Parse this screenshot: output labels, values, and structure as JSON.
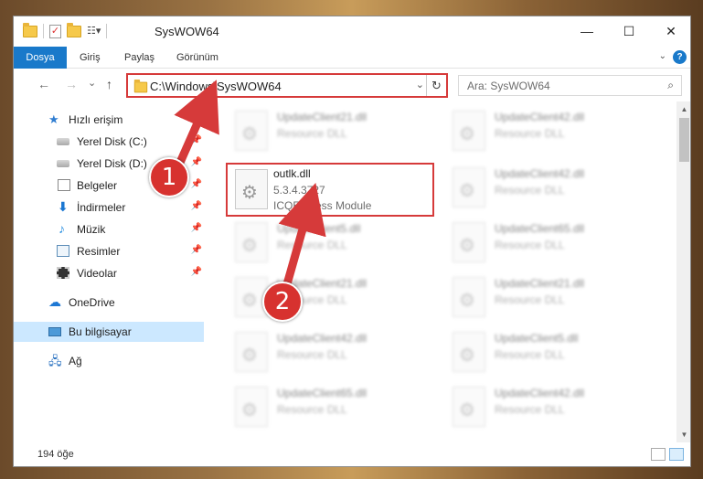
{
  "window": {
    "title": "SysWOW64",
    "controls": {
      "minimize": "—",
      "maximize": "☐",
      "close": "✕"
    }
  },
  "ribbon": {
    "tabs": [
      "Dosya",
      "Giriş",
      "Paylaş",
      "Görünüm"
    ],
    "help": "?"
  },
  "nav": {
    "back": "←",
    "forward": "→",
    "recent": "⌄",
    "up": "↑",
    "address": "C:\\Windows\\SysWOW64",
    "search_placeholder": "Ara: SysWOW64",
    "refresh": "↻",
    "search_icon": "⌕"
  },
  "sidebar": {
    "items": [
      {
        "label": "Hızlı erişim",
        "icon": "star-icon",
        "pinned": false
      },
      {
        "label": "Yerel Disk (C:)",
        "icon": "disk-icon",
        "pinned": true
      },
      {
        "label": "Yerel Disk (D:)",
        "icon": "disk-icon",
        "pinned": true
      },
      {
        "label": "Belgeler",
        "icon": "documents-icon",
        "pinned": true
      },
      {
        "label": "İndirmeler",
        "icon": "download-icon",
        "pinned": true
      },
      {
        "label": "Müzik",
        "icon": "music-icon",
        "pinned": true
      },
      {
        "label": "Resimler",
        "icon": "pictures-icon",
        "pinned": true
      },
      {
        "label": "Videolar",
        "icon": "videos-icon",
        "pinned": true
      },
      {
        "label": "OneDrive",
        "icon": "cloud-icon",
        "pinned": false
      },
      {
        "label": "Bu bilgisayar",
        "icon": "computer-icon",
        "pinned": false,
        "selected": true
      },
      {
        "label": "Ağ",
        "icon": "network-icon",
        "pinned": false
      }
    ],
    "pin_glyph": "📌"
  },
  "files": {
    "left": [
      {
        "name": "UpdateClient21.dll",
        "desc": "Resource DLL"
      },
      {
        "name": "outlk.dll",
        "version": "5.3.4.3727",
        "desc": "ICQExpress Module",
        "highlighted": true
      },
      {
        "name": "UpdateClient5.dll",
        "desc": "Resource DLL"
      },
      {
        "name": "UpdateClient21.dll",
        "desc": "Resource DLL"
      },
      {
        "name": "UpdateClient42.dll",
        "desc": "Resource DLL"
      },
      {
        "name": "UpdateClient65.dll",
        "desc": "Resource DLL"
      }
    ],
    "right": [
      {
        "name": "UpdateClient42.dll",
        "desc": "Resource DLL"
      },
      {
        "name": "UpdateClient42.dll",
        "desc": "Resource DLL"
      },
      {
        "name": "UpdateClient65.dll",
        "desc": "Resource DLL"
      },
      {
        "name": "UpdateClient21.dll",
        "desc": "Resource DLL"
      },
      {
        "name": "UpdateClient5.dll",
        "desc": "Resource DLL"
      },
      {
        "name": "UpdateClient42.dll",
        "desc": "Resource DLL"
      }
    ]
  },
  "status": {
    "item_count": "194 öğe"
  },
  "annotations": {
    "step1": "1",
    "step2": "2",
    "color": "#d63a3a"
  }
}
